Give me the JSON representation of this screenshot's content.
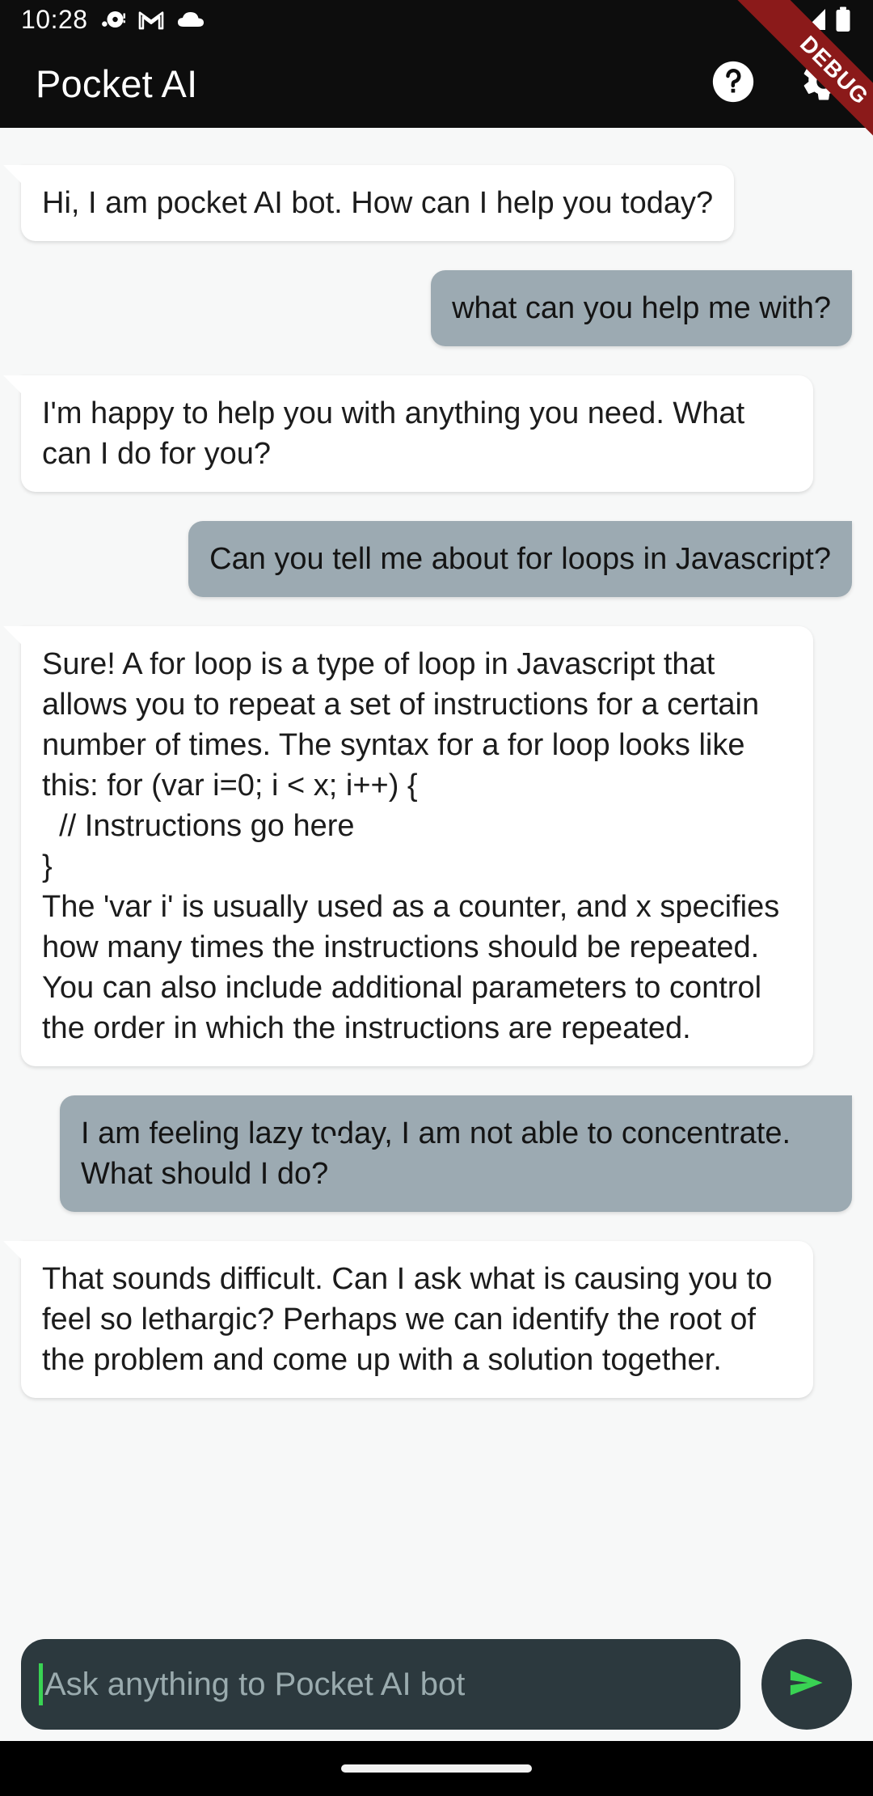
{
  "status_bar": {
    "time": "10:28",
    "left_icons": [
      "notification-dot-icon",
      "gmail-icon",
      "cloud-icon"
    ],
    "right_icons": [
      "wifi-icon",
      "cellular-signal-icon",
      "battery-icon"
    ],
    "background_color": "#0D0D0D"
  },
  "debug_banner": {
    "label": "DEBUG",
    "color": "#8B1A1A"
  },
  "app_bar": {
    "title": "Pocket AI",
    "help_label": "help-circle-icon",
    "settings_label": "gear-icon",
    "background_color": "#0D0D0D"
  },
  "theme": {
    "chat_background": "#F7F8F8",
    "bot_bubble_color": "#FFFFFF",
    "user_bubble_color": "#9CAAB2",
    "input_background": "#2C393E",
    "accent_green": "#39D353"
  },
  "messages": [
    {
      "sender": "bot",
      "text": "Hi, I am pocket AI bot. How can I help you today?"
    },
    {
      "sender": "user",
      "text": "what can you help me with?"
    },
    {
      "sender": "bot",
      "text": "I'm happy to help you with anything you need. What can I do for you?"
    },
    {
      "sender": "user",
      "text": "Can you tell me about for loops in Javascript?"
    },
    {
      "sender": "bot",
      "text": "Sure! A for loop is a type of loop in Javascript that allows you to repeat a set of instructions for a certain number of times. The syntax for a for loop looks like this: for (var i=0; i < x; i++) {\n  // Instructions go here\n}\nThe 'var i' is usually used as a counter, and x specifies how many times the instructions should be repeated. You can also include additional parameters to control the order in which the instructions are repeated."
    },
    {
      "sender": "user",
      "text": "I am feeling lazy today, I am not able to concentrate. What should I do?"
    },
    {
      "sender": "bot",
      "text": "That sounds difficult. Can I ask what is causing you to feel so lethargic? Perhaps we can identify the root of the problem and come up with a solution together."
    }
  ],
  "composer": {
    "placeholder": "Ask anything to Pocket AI bot",
    "value": "",
    "send_label": "send-icon"
  }
}
